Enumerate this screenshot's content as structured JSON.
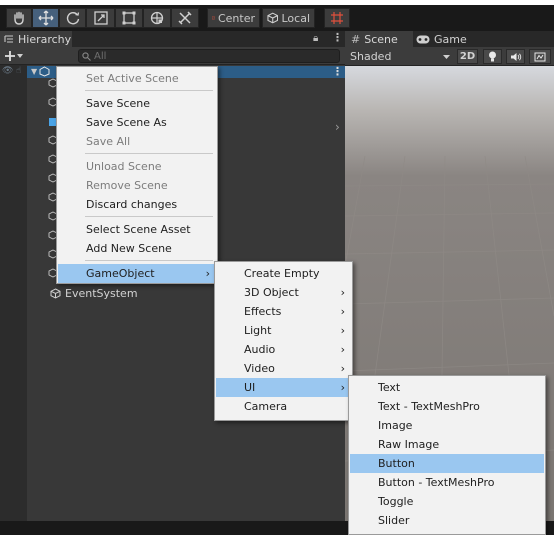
{
  "toolbar": {
    "tools": [
      "hand-tool",
      "move-tool",
      "rotate-tool",
      "scale-tool",
      "rect-tool",
      "transform-tool",
      "custom-tool"
    ],
    "active_tool": "move-tool",
    "pivot_label": "Center",
    "space_label": "Local",
    "accent_color": "#46607c"
  },
  "hierarchy": {
    "tab_label": "Hierarchy",
    "search_placeholder": "All",
    "event_system_label": "EventSystem",
    "selection_color": "#2c5d87"
  },
  "scene": {
    "scene_tab_label": "Scene",
    "game_tab_label": "Game",
    "shading_mode": "Shaded",
    "mode_2d_label": "2D"
  },
  "context_menu": {
    "items": [
      {
        "label": "Set Active Scene",
        "disabled": true
      },
      {
        "label": "Save Scene",
        "disabled": false
      },
      {
        "label": "Save Scene As",
        "disabled": false
      },
      {
        "label": "Save All",
        "disabled": true
      },
      {
        "label": "Unload Scene",
        "disabled": true
      },
      {
        "label": "Remove Scene",
        "disabled": true
      },
      {
        "label": "Discard changes",
        "disabled": false
      },
      {
        "label": "Select Scene Asset",
        "disabled": false
      },
      {
        "label": "Add New Scene",
        "disabled": false
      },
      {
        "label": "GameObject",
        "highlighted": true,
        "submenu": true
      }
    ]
  },
  "gameobject_menu": {
    "items": [
      {
        "label": "Create Empty"
      },
      {
        "label": "3D Object",
        "submenu": true
      },
      {
        "label": "Effects",
        "submenu": true
      },
      {
        "label": "Light",
        "submenu": true
      },
      {
        "label": "Audio",
        "submenu": true
      },
      {
        "label": "Video",
        "submenu": true
      },
      {
        "label": "UI",
        "submenu": true,
        "highlighted": true
      },
      {
        "label": "Camera"
      }
    ]
  },
  "ui_menu": {
    "items": [
      {
        "label": "Text"
      },
      {
        "label": "Text - TextMeshPro"
      },
      {
        "label": "Image"
      },
      {
        "label": "Raw Image"
      },
      {
        "label": "Button",
        "highlighted": true
      },
      {
        "label": "Button - TextMeshPro"
      },
      {
        "label": "Toggle"
      },
      {
        "label": "Slider"
      }
    ],
    "highlight_color": "#9ac7f0"
  },
  "submenu_arrow": "›"
}
